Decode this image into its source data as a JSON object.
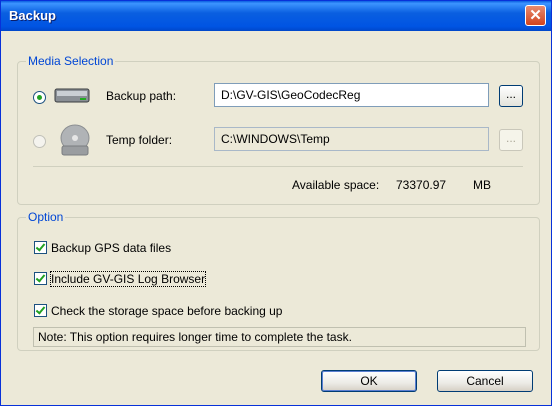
{
  "window": {
    "title": "Backup",
    "close_label": "✕"
  },
  "media_selection": {
    "legend": "Media Selection",
    "backup": {
      "label": "Backup path:",
      "value": "D:\\GV-GIS\\GeoCodecReg",
      "browse_label": "...",
      "selected": true,
      "icon": "hard-drive-icon"
    },
    "temp": {
      "label": "Temp folder:",
      "value": "C:\\WINDOWS\\Temp",
      "browse_label": "...",
      "selected": false,
      "icon": "disc-drive-icon"
    },
    "available_label": "Available space:",
    "available_value": "73370.97",
    "available_unit": "MB"
  },
  "option": {
    "legend": "Option",
    "checkboxes": [
      {
        "label": "Backup GPS data files",
        "checked": true
      },
      {
        "label": "Include GV-GIS Log Browser",
        "checked": true
      },
      {
        "label": "Check the storage space before backing up",
        "checked": true
      }
    ],
    "note": "Note: This option requires longer time to complete the task."
  },
  "buttons": {
    "ok": "OK",
    "cancel": "Cancel"
  },
  "colors": {
    "title_bar": "#0054e3",
    "legend": "#0046d5",
    "check": "#21a121",
    "dialog_bg": "#ece9d8"
  }
}
